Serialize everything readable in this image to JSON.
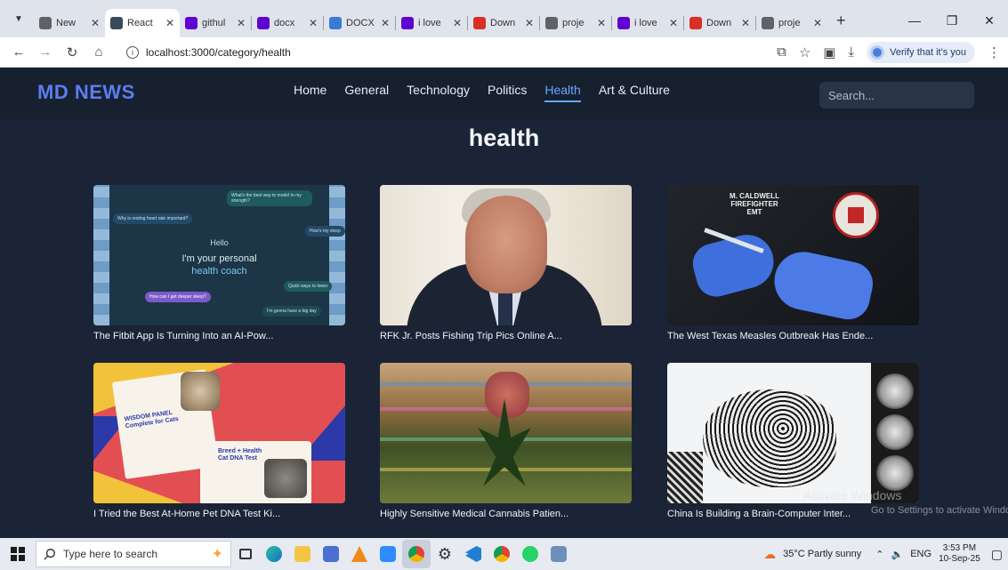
{
  "browser": {
    "tabs": [
      {
        "label": "New",
        "icon": "chrome-icon",
        "color": "#5f6368",
        "active": false
      },
      {
        "label": "React",
        "icon": "react-app-icon",
        "color": "#3b4a5a",
        "active": true
      },
      {
        "label": "githul",
        "icon": "yahoo-icon",
        "color": "#6001d2",
        "active": false
      },
      {
        "label": "docx",
        "icon": "yahoo-icon",
        "color": "#6001d2",
        "active": false
      },
      {
        "label": "DOCX",
        "icon": "circle-icon",
        "color": "#3a7bd5",
        "active": false
      },
      {
        "label": "i love",
        "icon": "yahoo-icon",
        "color": "#6001d2",
        "active": false
      },
      {
        "label": "Down",
        "icon": "heart-icon",
        "color": "#d93025",
        "active": false
      },
      {
        "label": "proje",
        "icon": "chrome-icon",
        "color": "#5f6368",
        "active": false
      },
      {
        "label": "i love",
        "icon": "yahoo-icon",
        "color": "#6001d2",
        "active": false
      },
      {
        "label": "Down",
        "icon": "heart-icon",
        "color": "#d93025",
        "active": false
      },
      {
        "label": "proje",
        "icon": "chrome-icon",
        "color": "#5f6368",
        "active": false
      }
    ],
    "url": "localhost:3000/category/health",
    "verify_label": "Verify that it's you"
  },
  "site": {
    "logo": "MD NEWS",
    "nav": [
      "Home",
      "General",
      "Technology",
      "Politics",
      "Health",
      "Art & Culture"
    ],
    "active_nav": "Health",
    "search_placeholder": "Search...",
    "category_heading": "health",
    "accent": "#64a8ff",
    "logo_color": "#5b7df0"
  },
  "articles": [
    {
      "title": "The Fitbit App Is Turning Into an AI-Pow...",
      "image": "fitbit-ai-coach-image"
    },
    {
      "title": "RFK Jr. Posts Fishing Trip Pics Online A...",
      "image": "rfk-portrait-image"
    },
    {
      "title": "The West Texas Measles Outbreak Has Ende...",
      "image": "vaccine-syringe-image"
    },
    {
      "title": "I Tried the Best At-Home Pet DNA Test Ki...",
      "image": "pet-dna-kit-image"
    },
    {
      "title": "Highly Sensitive Medical Cannabis Patien...",
      "image": "cannabis-leaf-image"
    },
    {
      "title": "China Is Building a Brain-Computer Inter...",
      "image": "brain-computer-image"
    }
  ],
  "thumb_text": {
    "fitbit_hello": "Hello",
    "fitbit_coach_1": "I'm your personal",
    "fitbit_coach_2": "health coach",
    "fitbit_bubbles": [
      "What's the best way to model to my strength?",
      "Why is resting heart rate important?",
      "How's my sleep",
      "Quick ways to lower",
      "How can I get deeper sleep?",
      "I'm gonna have a big day"
    ],
    "firefighter_text": "M. CALDWELL\nFIREFIGHTER\nEMT",
    "petdna_box1": "WISDOM PANEL\nComplete for Cats",
    "petdna_box2": "Breed + Health\nCat DNA Test"
  },
  "watermark": {
    "line1": "Activate Windows",
    "line2": "Go to Settings to activate Windows."
  },
  "taskbar": {
    "search_placeholder": "Type here to search",
    "weather": "35°C  Partly sunny",
    "language": "ENG",
    "time": "3:53 PM",
    "date": "10-Sep-25"
  }
}
